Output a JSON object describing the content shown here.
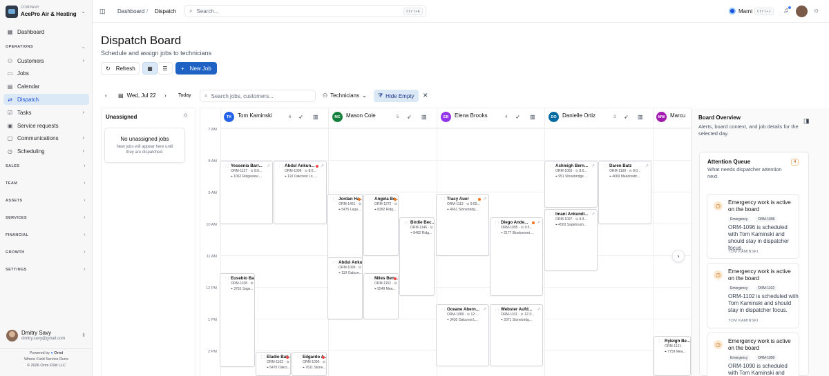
{
  "sidebar": {
    "company_caption": "COMPANY",
    "company_name": "AcePro Air & Heating",
    "dashboard": "Dashboard",
    "operations_section": "OPERATIONS",
    "items": [
      {
        "label": "Customers"
      },
      {
        "label": "Jobs"
      },
      {
        "label": "Calendar"
      },
      {
        "label": "Dispatch"
      },
      {
        "label": "Tasks"
      },
      {
        "label": "Service requests"
      },
      {
        "label": "Communications"
      },
      {
        "label": "Scheduling"
      }
    ],
    "sections": [
      "SALES",
      "TEAM",
      "ASSETS",
      "SERVICES",
      "FINANCIAL",
      "GROWTH",
      "SETTINGS"
    ],
    "user_name": "Dmitry Savy",
    "user_email": "dmitry.savy@gmail.com",
    "powered_by": "Powered by",
    "brand": "Ormi",
    "tagline": "Where Field Service Runs",
    "copyright": "© 2026 Ormi FSM LLC"
  },
  "header": {
    "crumb1": "Dashboard",
    "sep": "/",
    "crumb2": "Dispatch",
    "search_placeholder": "Search...",
    "search_kbd": "Ctrl+K",
    "assistant": "Marni",
    "assistant_kbd": "Ctrl+J"
  },
  "page": {
    "title": "Dispatch Board",
    "subtitle": "Schedule and assign jobs to technicians",
    "refresh": "Refresh",
    "new_job": "New Job"
  },
  "toolbar": {
    "date": "Wed, Jul 22",
    "today": "Today",
    "search_placeholder": "Search jobs, customers...",
    "technicians": "Technicians",
    "hide_empty": "Hide Empty"
  },
  "unassigned": {
    "title": "Unassigned",
    "count": "0",
    "empty_title": "No unassigned jobs",
    "empty_text": "New jobs will appear here until they are dispatched."
  },
  "technicians": [
    {
      "initials": "TK",
      "name": "Tom Kaminski",
      "count": "6",
      "color": "#2563eb"
    },
    {
      "initials": "MC",
      "name": "Mason Cole",
      "count": "5",
      "color": "#15803d"
    },
    {
      "initials": "EB",
      "name": "Elena Brooks",
      "count": "4",
      "color": "#9333ea"
    },
    {
      "initials": "DO",
      "name": "Danielle Ortiz",
      "count": "3",
      "color": "#0369a1"
    },
    {
      "initials": "MW",
      "name": "Marcu",
      "count": "",
      "color": "#a21caf"
    }
  ],
  "times": [
    "7 AM",
    "8 AM",
    "9 AM",
    "10 AM",
    "11 AM",
    "12 PM",
    "1 PM",
    "2 PM"
  ],
  "jobs": [
    {
      "name": "Yessenia Barr...",
      "meta": "ORM-1137 · ⊙ 8:0...",
      "addr": "1062 Ridgeview ..."
    },
    {
      "name": "Abdul Ankun...",
      "meta": "ORM-1096 · ⊙ 8:0...",
      "addr": "110 Oakcrest Ln, ..."
    },
    {
      "name": "Jordan Ha...",
      "meta": "ORM-1451 · ⊙ 1",
      "addr": "5475 Lega..."
    },
    {
      "name": "Angela Be...",
      "meta": "ORM-1272 · ⊙",
      "addr": "8282 Ridg..."
    },
    {
      "name": "Birdie Bec...",
      "meta": "ORM-1146 · ⊙",
      "addr": "8462 Ridg..."
    },
    {
      "name": "Tracy Auer",
      "meta": "ORM-1113 · ⊙ 9:00...",
      "addr": "4661 Stonebridg..."
    },
    {
      "name": "Diego Ande...",
      "meta": "ORM-1095 · ⊙ 9:5...",
      "addr": "2177 Bluebonnet ..."
    },
    {
      "name": "Ashleigh Bern...",
      "meta": "ORM-1065 · ⊙ 8:0...",
      "addr": "951 Stonebridge ..."
    },
    {
      "name": "Daren Batz",
      "meta": "ORM-1109 · ⊙ 8:0...",
      "addr": "4069 Meadowbr..."
    },
    {
      "name": "Imani Ankundi...",
      "meta": "ORM-1097 · ⊙ 9:3...",
      "addr": "4503 Sagebrush..."
    },
    {
      "name": "Abdul Anku...",
      "meta": "ORM-1099 · ⊙",
      "addr": "110 Oakcre..."
    },
    {
      "name": "Miles Ben...",
      "meta": "ORM-1152 · ⊙",
      "addr": "5549 Mea..."
    },
    {
      "name": "Eusebio Bas...",
      "meta": "ORM-1108 · ⊙",
      "addr": "3763 Sage..."
    },
    {
      "name": "Oceane Abern...",
      "meta": "ORM-1089 · ⊙ 12:...",
      "addr": "3430 Oakcrest L..."
    },
    {
      "name": "Webster Aufd...",
      "meta": "ORM-1101 · ⊙ 12:3...",
      "addr": "2071 Stonebridg..."
    },
    {
      "name": "Eladio Bah...",
      "meta": "ORM-1102 · ⊙",
      "addr": "5470 Oakcr..."
    },
    {
      "name": "Edgardo A...",
      "meta": "ORM-1090 · ⊙",
      "addr": "7611 Stone..."
    },
    {
      "name": "Ryleigh Be...",
      "meta": "ORM-1121 ·",
      "addr": "7759 Mea..."
    }
  ],
  "overview": {
    "title": "Board Overview",
    "subtitle": "Alerts, board context, and job details for the selected day.",
    "queue_title": "Attention Queue",
    "queue_sub": "What needs dispatcher attention next.",
    "queue_count": "4"
  },
  "alerts": [
    {
      "title": "Emergency work is active on the board",
      "tag": "Emergency",
      "id": "ORM-1096",
      "text": "ORM-1096 is scheduled with Tom Kaminski and should stay in dispatcher focus.",
      "tech": "TOM KAMINSKI"
    },
    {
      "title": "Emergency work is active on the board",
      "tag": "Emergency",
      "id": "ORM-1102",
      "text": "ORM-1102 is scheduled with Tom Kaminski and should stay in dispatcher focus.",
      "tech": "TOM KAMINSKI"
    },
    {
      "title": "Emergency work is active on the board",
      "tag": "Emergency",
      "id": "ORM-1090",
      "text": "ORM-1090 is scheduled with Tom Kaminski and should",
      "tech": ""
    }
  ]
}
